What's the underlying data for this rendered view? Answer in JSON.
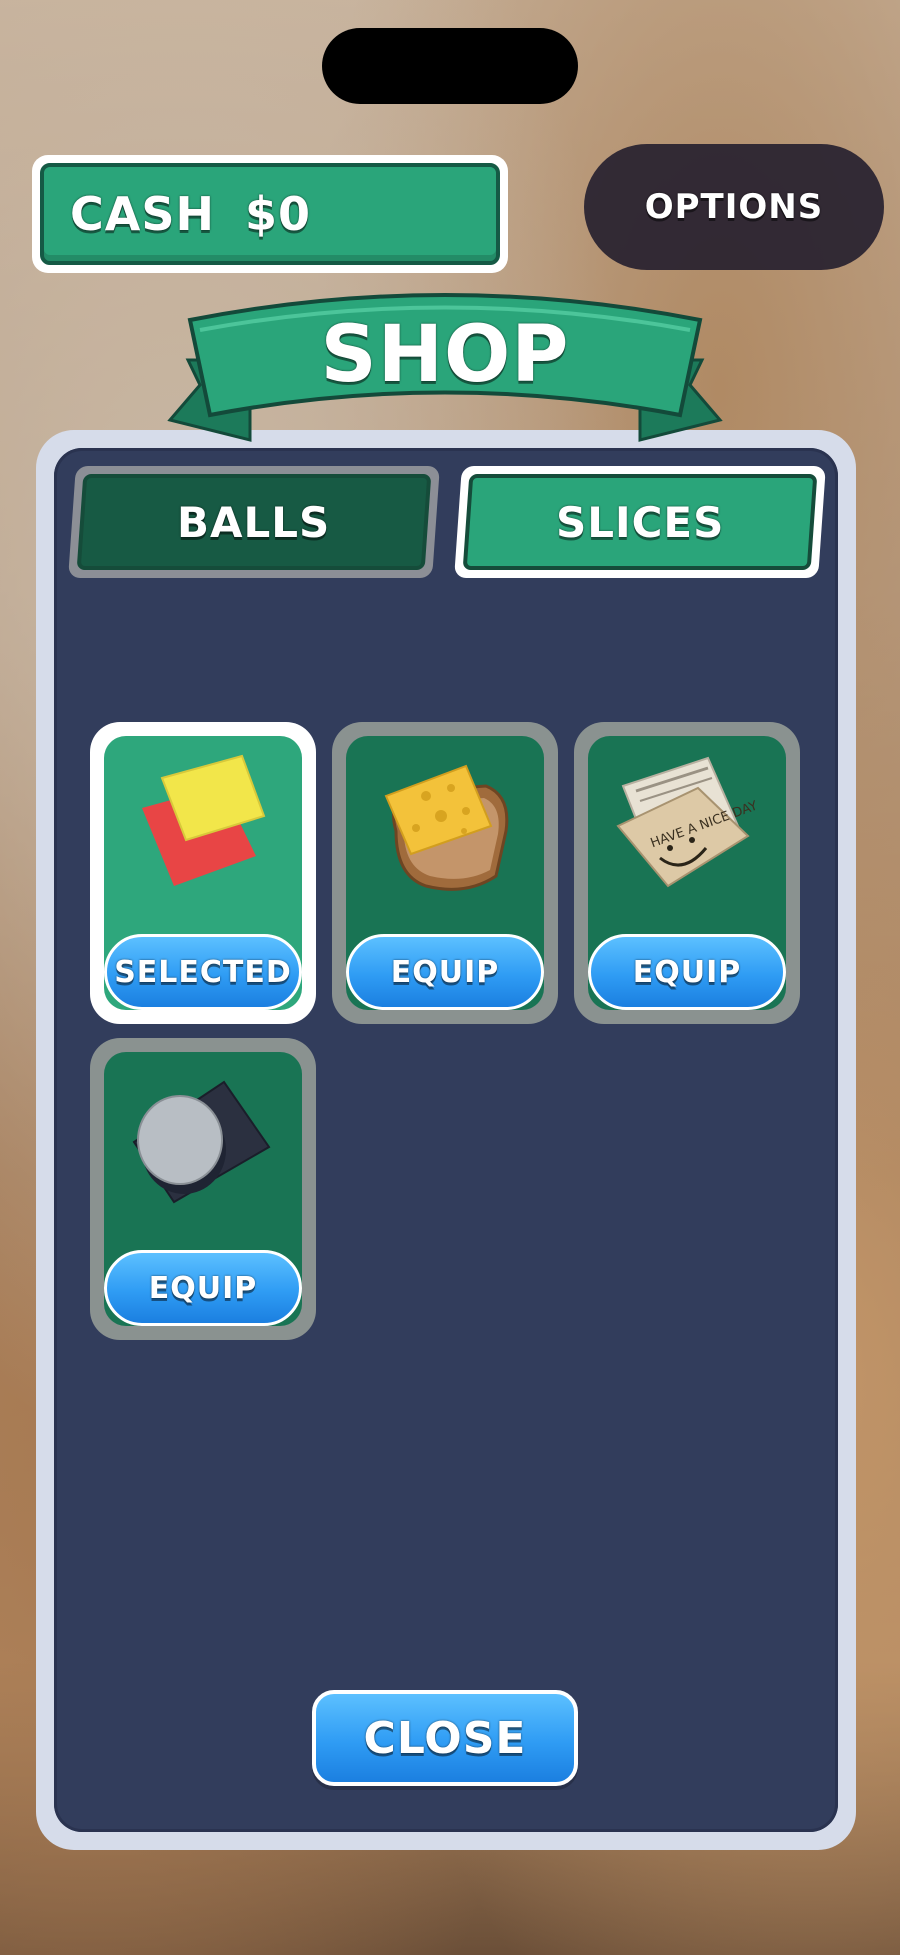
{
  "hud": {
    "cash_label": "CASH",
    "cash_value": "$0",
    "options_label": "OPTIONS"
  },
  "shop": {
    "title": "SHOP",
    "tabs": [
      {
        "label": "BALLS",
        "active": true
      },
      {
        "label": "SLICES",
        "active": false
      }
    ],
    "items": [
      {
        "icon": "paper-slice-icon",
        "button": "SELECTED",
        "state": "selected"
      },
      {
        "icon": "cheese-bread-slice-icon",
        "button": "EQUIP",
        "state": "available"
      },
      {
        "icon": "newspaper-slice-icon",
        "button": "EQUIP",
        "state": "available",
        "art_text": "HAVE A NICE DAY"
      },
      {
        "icon": "metal-disc-slice-icon",
        "button": "EQUIP",
        "state": "available"
      }
    ],
    "close_label": "CLOSE"
  },
  "colors": {
    "green": "#2aa57a",
    "dark_green": "#175a44",
    "panel": "#323d5c",
    "button_blue": "#2f9cf4"
  }
}
